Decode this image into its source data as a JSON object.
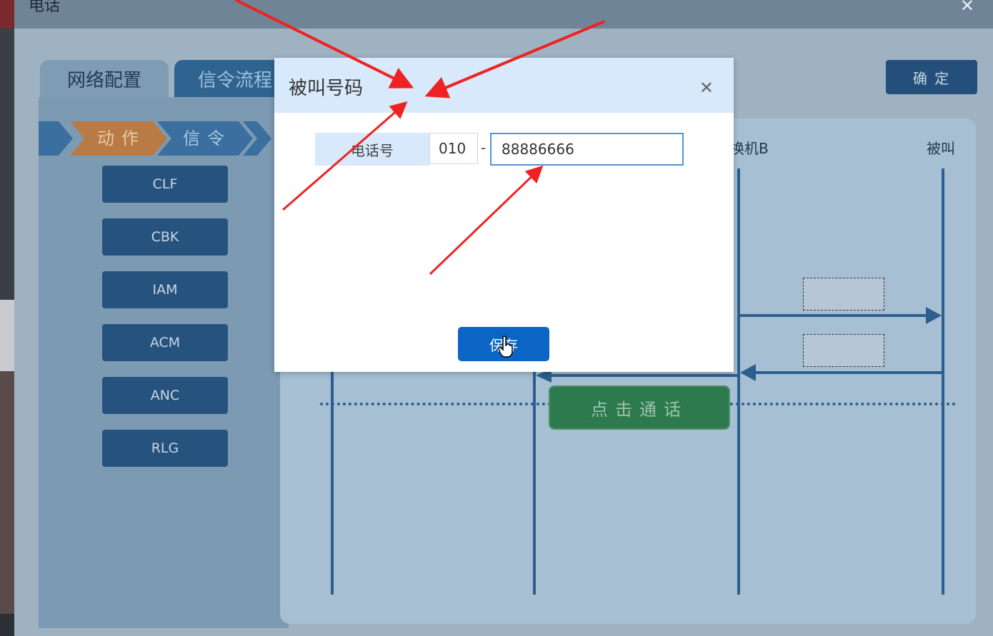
{
  "window": {
    "title": "电话"
  },
  "tabs": [
    {
      "label": "网络配置"
    },
    {
      "label": "信令流程"
    }
  ],
  "toolbar": {
    "confirm_label": "确 定"
  },
  "steps": {
    "action": "动作",
    "signal": "信令"
  },
  "actions": [
    {
      "label": "CLF"
    },
    {
      "label": "CBK"
    },
    {
      "label": "IAM"
    },
    {
      "label": "ACM"
    },
    {
      "label": "ANC"
    },
    {
      "label": "RLG"
    }
  ],
  "flow": {
    "lanes": [
      {
        "label": "换机B"
      },
      {
        "label": "被叫"
      }
    ],
    "call_button": "点击通话"
  },
  "dialog": {
    "title": "被叫号码",
    "phone_label": "电话号",
    "area_code": "010",
    "separator": "-",
    "number": "88886666",
    "save_label": "保存"
  },
  "colors": {
    "accent": "#0b65c4",
    "header_bg": "#d7e9fb",
    "annotation_arrow": "#ee2222"
  }
}
